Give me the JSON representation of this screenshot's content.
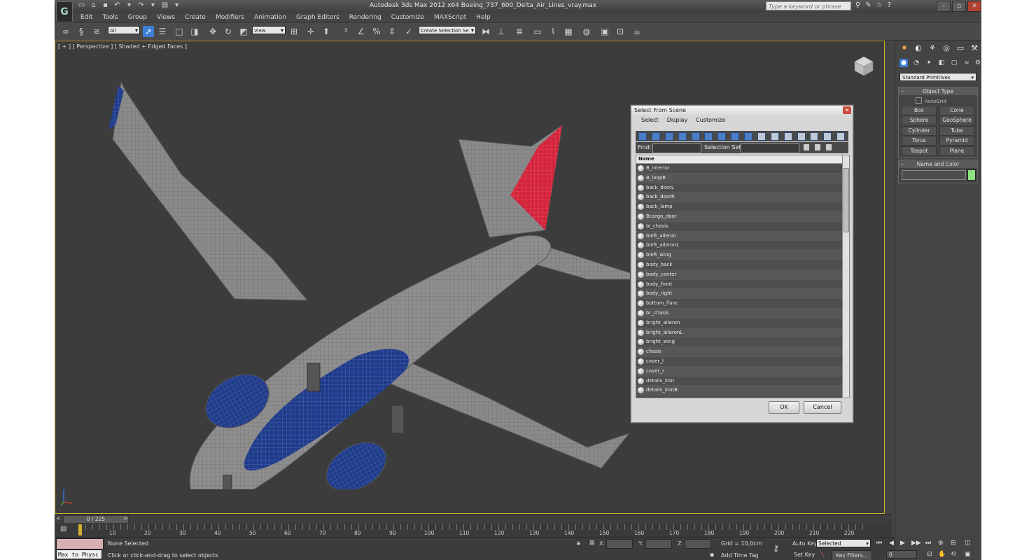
{
  "app": {
    "title": "Autodesk 3ds Max  2012 x64      Boeing_737_600_Delta_Air_Lines_vray.max",
    "search_placeholder": "Type a keyword or phrase"
  },
  "menu": [
    "Edit",
    "Tools",
    "Group",
    "Views",
    "Create",
    "Modifiers",
    "Animation",
    "Graph Editors",
    "Rendering",
    "Customize",
    "MAXScript",
    "Help"
  ],
  "toolbar": {
    "filter_value": "All",
    "ref_coord_value": "View",
    "named_selection_value": "Create Selection Se"
  },
  "viewport": {
    "label": "[ + ] [ Perspective ] [ Shaded + Edged Faces ]"
  },
  "dialog": {
    "title": "Select From Scene",
    "menu": [
      "Select",
      "Display",
      "Customize"
    ],
    "find_label": "Find:",
    "selection_set_label": "Selection Set:",
    "column_header": "Name",
    "items": [
      "B_interior",
      "B_loopR",
      "back_doorL",
      "back_doorR",
      "back_lamp",
      "Bcargo_door",
      "bl_chasis",
      "bleft_aileron",
      "bleft_aileronL",
      "bleft_wing",
      "body_back",
      "body_center",
      "body_front",
      "body_right",
      "bottom_flanc",
      "br_chasis",
      "bright_aileron",
      "bright_aileronL",
      "bright_wing",
      "chasis",
      "cover_l",
      "cover_r",
      "details_iron",
      "details_ironB"
    ],
    "ok_label": "OK",
    "cancel_label": "Cancel"
  },
  "command_panel": {
    "category_value": "Standard Primitives",
    "object_type_title": "Object Type",
    "autogrid_label": "AutoGrid",
    "primitives": [
      "Box",
      "Cone",
      "Sphere",
      "GeoSphere",
      "Cylinder",
      "Tube",
      "Torus",
      "Pyramid",
      "Teapot",
      "Plane"
    ],
    "name_color_title": "Name and Color",
    "object_color": "#8ee080"
  },
  "timeline": {
    "frame_display": "0 / 225",
    "ticks": [
      "10",
      "20",
      "30",
      "40",
      "50",
      "60",
      "70",
      "80",
      "90",
      "100",
      "110",
      "120",
      "130",
      "140",
      "150",
      "160",
      "170",
      "180",
      "190",
      "200",
      "210",
      "220"
    ],
    "current_frame": 0,
    "total_frames": 225
  },
  "status": {
    "maxscript_listener": "Max to Physc",
    "selection_status": "None Selected",
    "prompt": "Click or click-and-drag to select objects",
    "x_label": "X:",
    "y_label": "Y:",
    "z_label": "Z:",
    "grid": "Grid = 10,0cm",
    "add_time_tag": "Add Time Tag",
    "auto_key": "Auto Key",
    "set_key": "Set Key",
    "selected_dropdown": "Selected",
    "key_filters": "Key Filters...",
    "frame_value": "0"
  },
  "colors": {
    "livery_red": "#d3243c",
    "livery_blue": "#1f3b8a",
    "viewport_border": "#d4b030",
    "selection_blue": "#3d7fd8"
  }
}
